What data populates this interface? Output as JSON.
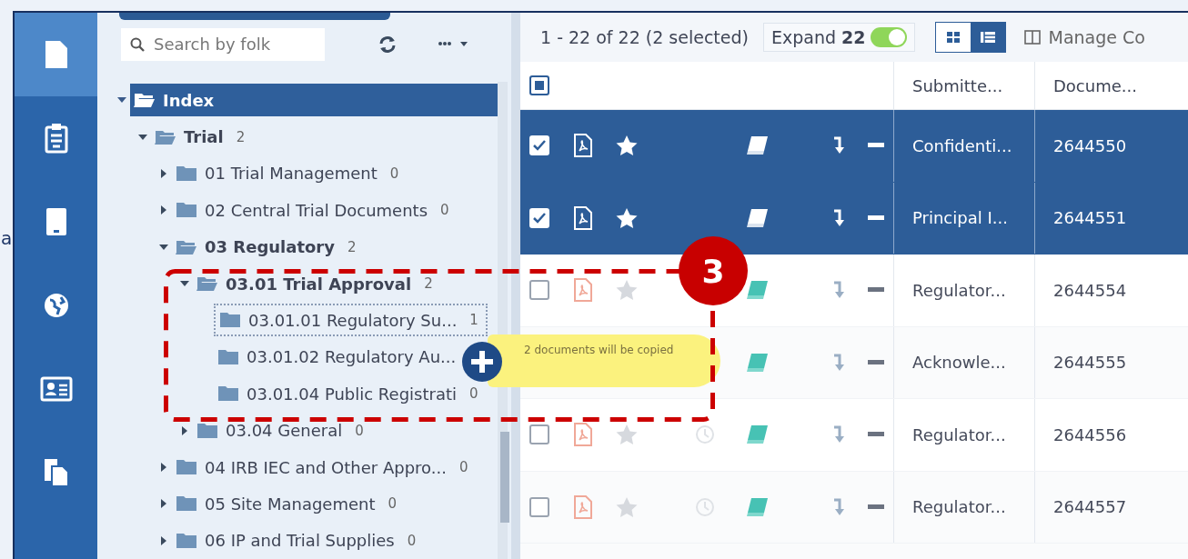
{
  "margin_text": "a",
  "nav": [
    {
      "kind": "document",
      "selected": true
    },
    {
      "kind": "clipboard",
      "selected": false
    },
    {
      "kind": "tablet",
      "selected": false
    },
    {
      "kind": "globe",
      "selected": false
    },
    {
      "kind": "card",
      "selected": false
    },
    {
      "kind": "copy",
      "selected": false
    }
  ],
  "folder_panel": {
    "search": {
      "placeholder": "Search by folk"
    },
    "tree": [
      {
        "name": "Index",
        "selected": true,
        "expanded": true,
        "children": [
          {
            "name": "Trial",
            "count": "2",
            "selected": false,
            "expanded": true,
            "children": [
              {
                "name": "01 Trial Management",
                "count": "0",
                "selected": false,
                "expanded": false
              },
              {
                "name": "02 Central Trial Documents",
                "count": "0",
                "selected": false,
                "expanded": false
              },
              {
                "name": "03 Regulatory",
                "count": "2",
                "selected": false,
                "expanded": true,
                "children": [
                  {
                    "name": "03.01 Trial Approval",
                    "count": "2",
                    "selected": false,
                    "expanded": true,
                    "children": [
                      {
                        "name": "03.01.01 Regulatory Su...",
                        "count": "1",
                        "selected": false,
                        "drop_target": true
                      },
                      {
                        "name": "03.01.02 Regulatory Au...",
                        "selected": false,
                        "drop_target": false
                      },
                      {
                        "name": "03.01.04 Public Registrati",
                        "count": "0",
                        "selected": false,
                        "drop_target": false
                      }
                    ]
                  },
                  {
                    "name": "03.04 General",
                    "count": "0",
                    "selected": false,
                    "expanded": false
                  }
                ]
              },
              {
                "name": "04 IRB IEC and Other Appro...",
                "count": "0",
                "selected": false,
                "expanded": false
              },
              {
                "name": "05 Site Management",
                "count": "0",
                "selected": false,
                "expanded": false
              },
              {
                "name": "06 IP and Trial Supplies",
                "count": "0",
                "selected": false,
                "expanded": false
              }
            ]
          }
        ]
      }
    ]
  },
  "toolbar": {
    "range": "1 - 22 of 22 (2 selected)",
    "expand": {
      "label": "Expand",
      "count": "22",
      "on": true
    },
    "views": [
      {
        "kind": "grid",
        "selected": false
      },
      {
        "kind": "list",
        "selected": true
      }
    ],
    "manage": "Manage Co"
  },
  "table": {
    "select_all_partial": true,
    "columns": [
      "Submitte...",
      "Docume..."
    ],
    "rows": [
      {
        "selected": true,
        "checked": true,
        "history": false,
        "submitted": "Confidenti...",
        "document": "2644550"
      },
      {
        "selected": true,
        "checked": true,
        "history": false,
        "submitted": "Principal I...",
        "document": "2644551"
      },
      {
        "selected": false,
        "checked": false,
        "history": false,
        "submitted": "Regulator...",
        "document": "2644554"
      },
      {
        "selected": false,
        "history": false,
        "submitted": "Acknowle...",
        "document": "2644555"
      },
      {
        "selected": false,
        "checked": false,
        "history": true,
        "submitted": "Regulator...",
        "document": "2644556"
      },
      {
        "selected": false,
        "checked": false,
        "history": true,
        "submitted": "Regulator...",
        "document": "2644557"
      }
    ]
  },
  "drag": {
    "message": "2 documents will be copied"
  },
  "annotation": {
    "number": "3"
  }
}
